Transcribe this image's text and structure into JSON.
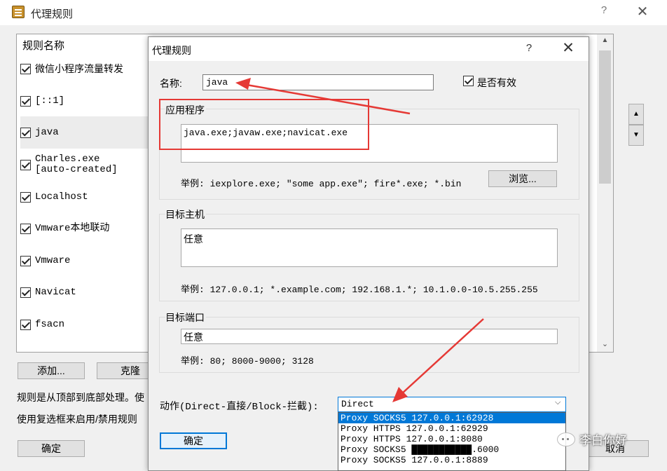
{
  "outer_window": {
    "title": "代理规则",
    "help_glyph": "?",
    "close_glyph": "✕",
    "list_header": "规则名称",
    "rules": [
      {
        "label": "微信小程序流量转发",
        "checked": true
      },
      {
        "label": "[::1]",
        "checked": true
      },
      {
        "label": "java",
        "checked": true,
        "selected": true
      },
      {
        "label": "Charles.exe\n[auto-created]",
        "checked": true
      },
      {
        "label": "Localhost",
        "checked": true
      },
      {
        "label": "Vmware本地联动",
        "checked": true
      },
      {
        "label": "Vmware",
        "checked": true
      },
      {
        "label": "Navicat",
        "checked": true
      },
      {
        "label": "fsacn",
        "checked": true
      }
    ],
    "add_button": "添加...",
    "clone_button": "克隆",
    "note_1": "规则是从顶部到底部处理。使",
    "note_2": "使用复选框来启用/禁用规则",
    "ok_button": "确定",
    "cancel_button": "取消"
  },
  "dialog": {
    "title": "代理规则",
    "help_glyph": "?",
    "close_glyph": "✕",
    "name_label": "名称:",
    "name_value": "java",
    "enabled_label": "是否有效",
    "enabled_checked": true,
    "apps_title": "应用程序",
    "apps_value": "java.exe;javaw.exe;navicat.exe",
    "apps_example": "举例: iexplore.exe; \"some app.exe\"; fire*.exe; *.bin",
    "browse_button": "浏览...",
    "hosts_title": "目标主机",
    "hosts_value": "任意",
    "hosts_example": "举例: 127.0.0.1; *.example.com; 192.168.1.*; 10.1.0.0-10.5.255.255",
    "ports_title": "目标端口",
    "ports_value": "任意",
    "ports_example": "举例: 80; 8000-9000; 3128",
    "action_label": "动作(Direct-直接/Block-拦截):",
    "action_value": "Direct",
    "action_options": [
      "Proxy SOCKS5 127.0.0.1:62928",
      "Proxy HTTPS 127.0.0.1:62929",
      "Proxy HTTPS 127.0.0.1:8080",
      "Proxy SOCKS5 ███████████.6000",
      "Proxy SOCKS5 127.0.0.1:8889"
    ],
    "ok_button": "确定"
  },
  "watermark": {
    "text": "李白你好"
  },
  "colors": {
    "annotation_red": "#e53935",
    "selection_blue": "#0078d7"
  }
}
